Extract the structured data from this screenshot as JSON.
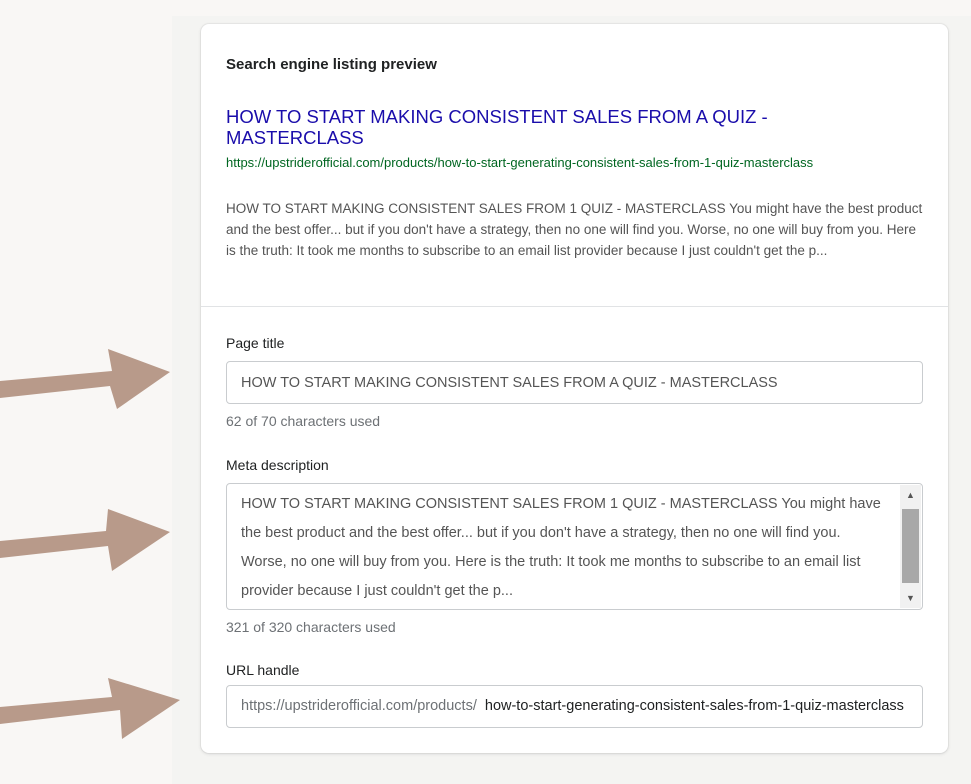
{
  "preview": {
    "heading": "Search engine listing preview",
    "title": "HOW TO START MAKING CONSISTENT SALES FROM A QUIZ - MASTERCLASS",
    "url": "https://upstriderofficial.com/products/how-to-start-generating-consistent-sales-from-1-quiz-masterclass",
    "description": "HOW TO START MAKING CONSISTENT SALES FROM 1 QUIZ - MASTERCLASS You might have the best product and the best offer... but if you don't have a strategy, then no one will find you. Worse, no one will buy from you. Here is the truth: It took me months to subscribe to an email list provider because I just couldn't get the p..."
  },
  "page_title": {
    "label": "Page title",
    "value": "HOW TO START MAKING CONSISTENT SALES FROM A QUIZ - MASTERCLASS",
    "counter": "62 of 70 characters used"
  },
  "meta_description": {
    "label": "Meta description",
    "value": "HOW TO START MAKING CONSISTENT SALES FROM 1 QUIZ - MASTERCLASS You might have the best product and the best offer... but if you don't have a strategy, then no one will find you. Worse, no one will buy from you. Here is the truth: It took me months to subscribe to an email list provider because I just couldn't get the p...",
    "counter": "321 of 320 characters used"
  },
  "url_handle": {
    "label": "URL handle",
    "prefix": "https://upstriderofficial.com/products/",
    "value": "how-to-start-generating-consistent-sales-from-1-quiz-masterclass"
  },
  "annotations": {
    "arrow_color": "#b89a8a",
    "arrow_count": 3
  }
}
